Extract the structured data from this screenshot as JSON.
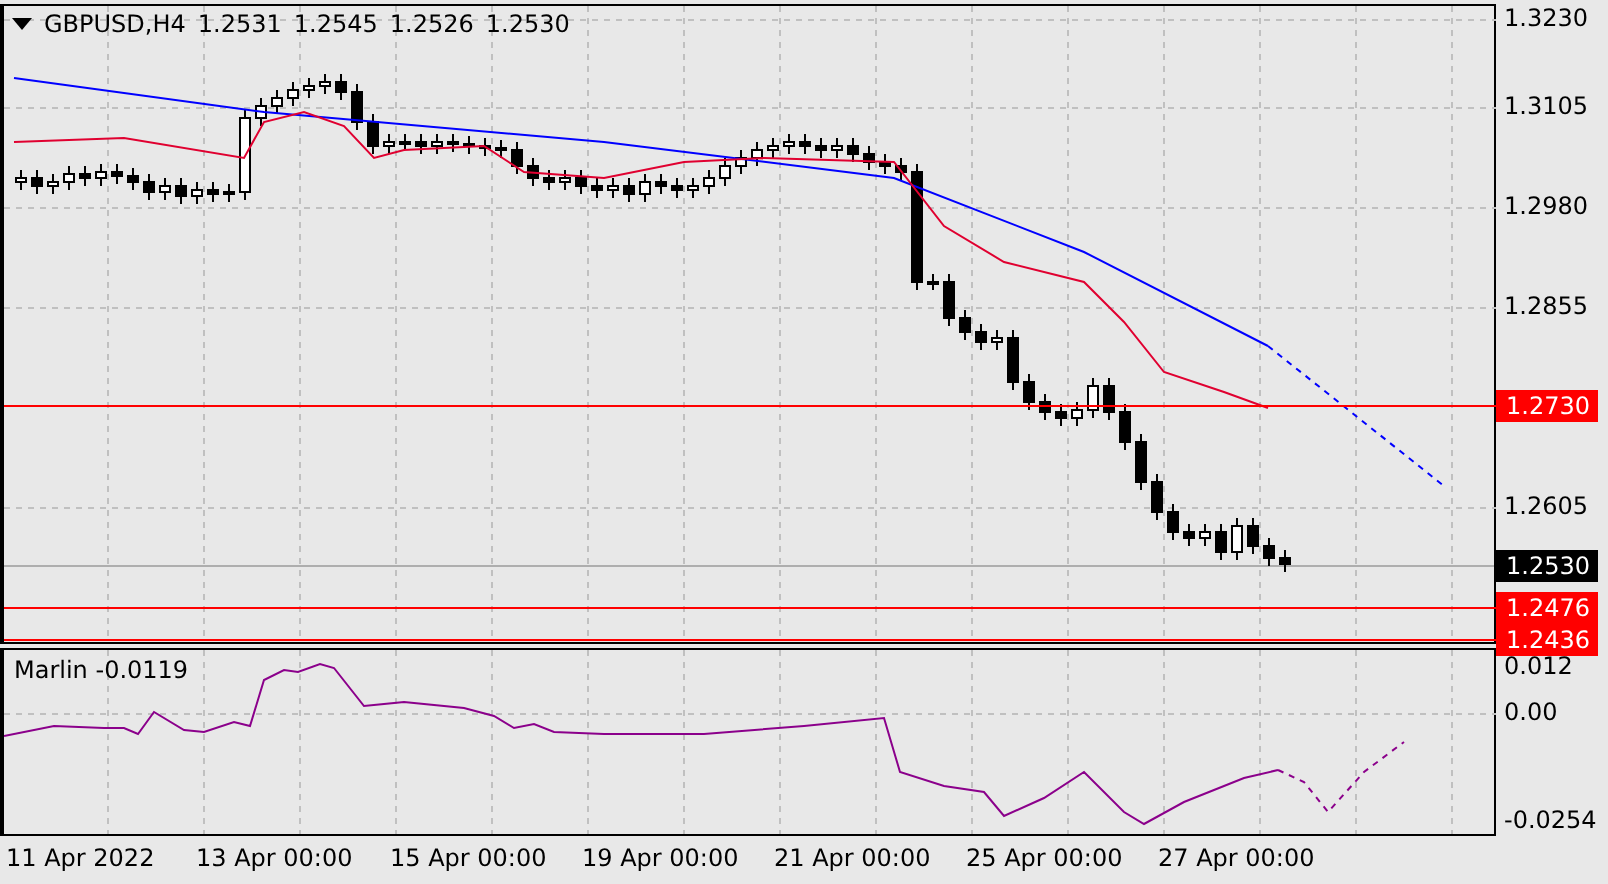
{
  "header": {
    "symbol": "GBPUSD,H4",
    "quote": [
      "1.2531",
      "1.2545",
      "1.2526",
      "1.2530"
    ]
  },
  "price_axis": [
    "1.3230",
    "1.3105",
    "1.2980",
    "1.2855",
    "1.2605"
  ],
  "price_tags": [
    {
      "label": "1.2730",
      "color": "#ff0000"
    },
    {
      "label": "1.2530",
      "color": "#000000"
    },
    {
      "label": "1.2476",
      "color": "#ff0000"
    },
    {
      "label": "1.2436",
      "color": "#ff0000"
    }
  ],
  "indicator": {
    "name": "Marlin",
    "value": "-0.0119",
    "axis": [
      "0.012",
      "0.00",
      "-0.0254"
    ]
  },
  "time_axis": [
    "11 Apr 2022",
    "13 Apr 00:00",
    "15 Apr 00:00",
    "19 Apr 00:00",
    "21 Apr 00:00",
    "25 Apr 00:00",
    "27 Apr 00:00"
  ]
}
